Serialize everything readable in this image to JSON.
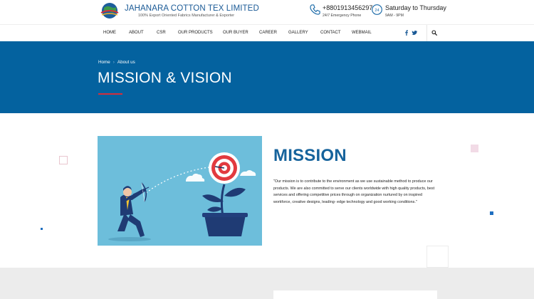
{
  "brand": {
    "name": "JAHANARA COTTON TEX LIMITED",
    "tagline": "100% Export Oriented Fabrics Manufacturer & Exporter"
  },
  "contact": {
    "phone": "+8801913456297",
    "phone_sub": "24/7 Emergency Phone",
    "hours": "Saturday to Thursday",
    "hours_sub": "9AM - 9PM"
  },
  "nav": {
    "items": [
      "HOME",
      "ABOUT",
      "CSR",
      "OUR PRODUCTS",
      "OUR BUYER",
      "CAREER",
      "GALLERY",
      "CONTACT",
      "WEBMAIL"
    ],
    "icons": [
      "facebook-icon",
      "twitter-icon",
      "search-icon"
    ]
  },
  "banner": {
    "breadcrumb": [
      "Home",
      "About us"
    ],
    "title": "MISSION & VISION"
  },
  "mission": {
    "heading": "MISSION",
    "text": "\"Our mission is to contribute to the environment as we use sustainable method to produce our products. We are also committed to serve our clients worldwide with high quality products, best services and offering competitive prices through on organization nurtured by on inspired workforce, creative designs, leading- edge technology and good working conditions.\""
  },
  "colors": {
    "brand_blue": "#04629f",
    "heading_blue": "#16639c",
    "accent_red": "#d62e3a"
  }
}
